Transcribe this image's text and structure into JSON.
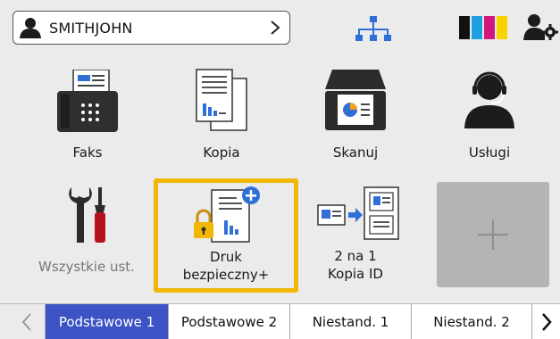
{
  "topbar": {
    "user_name": "SMITHJOHN"
  },
  "tiles": {
    "faks": "Faks",
    "kopia": "Kopia",
    "skanuj": "Skanuj",
    "uslugi": "Usługi",
    "settings": "Wszystkie ust.",
    "secure_line1": "Druk",
    "secure_line2": "bezpieczny+",
    "idcopy_line1": "2 na 1",
    "idcopy_line2": "Kopia ID",
    "add": "+"
  },
  "tabs": [
    {
      "label": "Podstawowe 1"
    },
    {
      "label": "Podstawowe 2"
    },
    {
      "label": "Niestand. 1"
    },
    {
      "label": "Niestand. 2"
    }
  ],
  "colors": {
    "accent_tab": "#3b53c4",
    "highlight_border": "#f2b705",
    "icon_dark": "#2b2b2b",
    "icon_blue": "#2f6fd6"
  }
}
